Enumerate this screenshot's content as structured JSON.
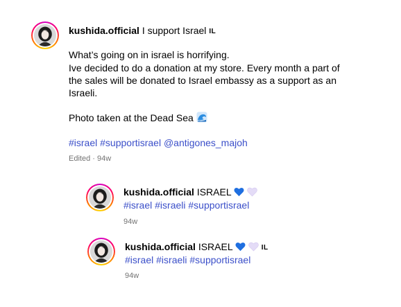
{
  "post": {
    "username": "kushida.official",
    "headline": "I support Israel",
    "flag_code": "IL",
    "body_lines": [
      "What’s going on in israel is horrifying.",
      "Ive decided to do a donation at my store. Every month a part of",
      "the sales will be donated to Israel embassy as a support as an",
      "Israeli."
    ],
    "photo_caption": "Photo taken at the Dead Sea",
    "caption_emoji": "wave-icon",
    "hashtags": [
      "#israel",
      "#supportisrael",
      "@antigones_majoh"
    ],
    "meta": "Edited · 94w"
  },
  "replies": [
    {
      "username": "kushida.official",
      "text": "ISRAEL",
      "emojis": [
        "blue-heart-icon",
        "white-heart-icon"
      ],
      "hashtags": [
        "#israel",
        "#israeli",
        "#supportisrael"
      ],
      "time": "94w"
    },
    {
      "username": "kushida.official",
      "text": "ISRAEL",
      "emojis": [
        "blue-heart-icon",
        "white-heart-icon"
      ],
      "flag_code": "IL",
      "hashtags": [
        "#israel",
        "#israeli",
        "#supportisrael"
      ],
      "time": "94w"
    }
  ],
  "colors": {
    "hashtag": "#3b4fc9",
    "meta": "#737373",
    "blue_heart": "#1f6fe0",
    "white_heart": "#e4dcf7"
  }
}
